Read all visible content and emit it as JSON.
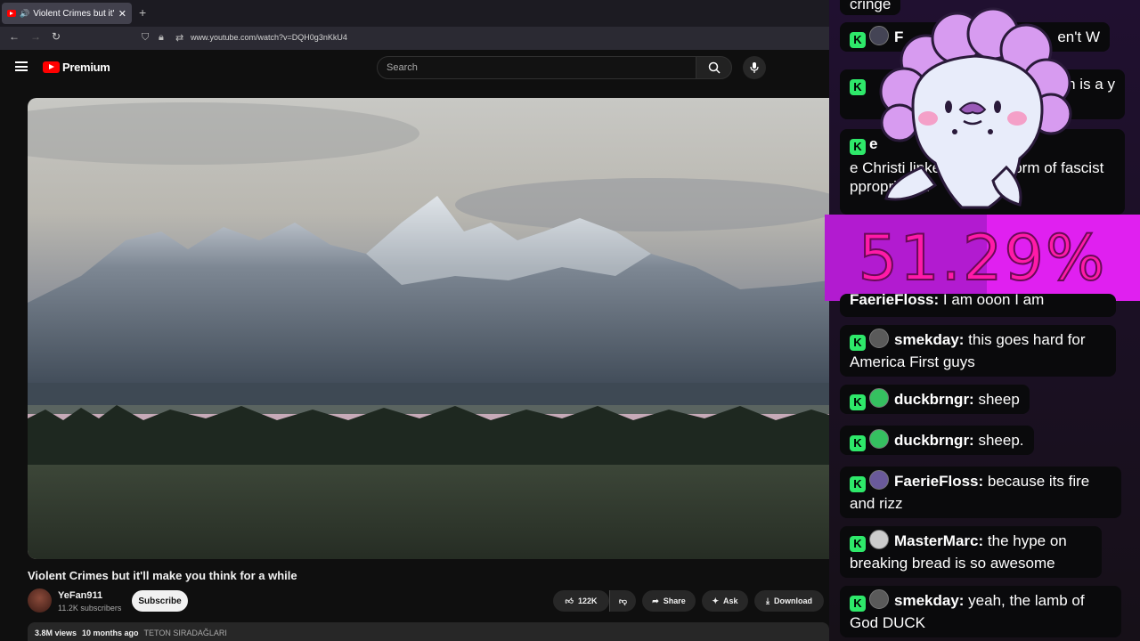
{
  "browser": {
    "tab_title": "Violent Crimes but it'll make",
    "url": "www.youtube.com/watch?v=DQH0g3nKkU4"
  },
  "youtube": {
    "brand": "Premium",
    "search_placeholder": "Search",
    "video_title": "Violent Crimes but it'll make you think for a while",
    "channel_name": "YeFan911",
    "subscribers": "11.2K subscribers",
    "subscribe_label": "Subscribe",
    "likes": "122K",
    "share_label": "Share",
    "ask_label": "Ask",
    "download_label": "Download",
    "views": "3.8M views",
    "age": "10 months ago",
    "location_tag": "TETON SIRADAĞLARI"
  },
  "poll": {
    "percent": "51.29%",
    "fill_fraction": 0.5129
  },
  "chat": [
    {
      "user": "",
      "text": "cringe"
    },
    {
      "user": "F",
      "text": "en't W"
    },
    {
      "user": "",
      "text": "agorn is a y"
    },
    {
      "user": "e",
      "text": "e Christi linked with em form of fascist ppropriation"
    },
    {
      "user": "FaerieFloss:",
      "text": "I am ooon I am"
    },
    {
      "user": "smekday:",
      "text": "this goes hard for America First guys"
    },
    {
      "user": "duckbrngr:",
      "text": "sheep"
    },
    {
      "user": "duckbrngr:",
      "text": "sheep."
    },
    {
      "user": "FaerieFloss:",
      "text": "because its fire and rizz"
    },
    {
      "user": "MasterMarc:",
      "text": "the hype on breaking bread is so awesome"
    },
    {
      "user": "smekday:",
      "text": "yeah, the lamb of God DUCK"
    }
  ],
  "colors": {
    "badge": "#2ee86a",
    "poll_bg": "#b21bd0",
    "poll_text": "#ff1aa8",
    "yt_red": "#ff0000"
  }
}
